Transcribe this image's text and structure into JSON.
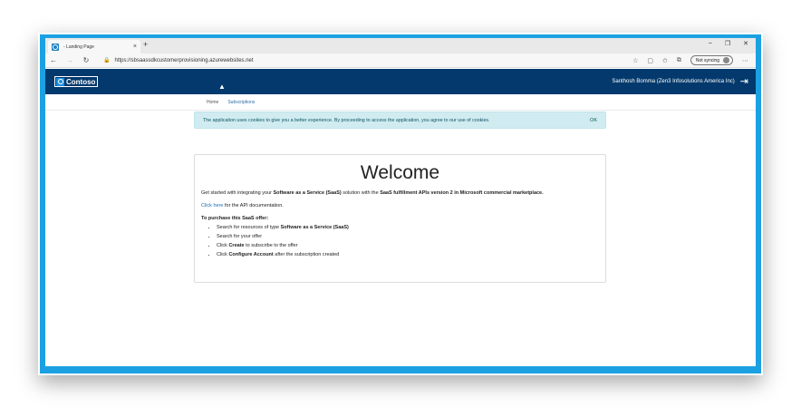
{
  "browser": {
    "tab_title": "- Landing Page",
    "tab_close": "×",
    "new_tab": "+",
    "controls": {
      "minimize": "–",
      "restore": "❐",
      "close": "✕"
    },
    "nav": {
      "back": "←",
      "forward": "→",
      "refresh": "↻",
      "lock": "🔒"
    },
    "url": "https://sbsaassdkcustomerprovisioning.azurewebsites.net",
    "toolbar_icons": {
      "favorite": "☆",
      "collections": "▢",
      "favorites_bar": "✩",
      "extensions": "⧉",
      "more": "⋯"
    },
    "sync_label": "Not syncing"
  },
  "app": {
    "logo_text": "Contoso",
    "user_name": "Santhosh Bomma (Zen3 Infosolutions America Inc)",
    "signout_icon": "⇥",
    "cursor": "▲",
    "subnav": {
      "home": "Home",
      "subscriptions": "Subscriptions"
    },
    "cookie": {
      "text": "The application uses cookies to give you a better experience. By proceeding to access the application, you agree to our use of cookies.",
      "ok": "OK"
    },
    "welcome": {
      "title": "Welcome",
      "intro_1": "Get started with integrating your ",
      "intro_bold_1": "Software as a Service (SaaS)",
      "intro_2": " solution with the ",
      "intro_bold_2": "SaaS fulfillment APIs version 2 in Microsoft commercial marketplace.",
      "doc_link": "Click here",
      "doc_rest": " for the API documentation.",
      "purchase_title": "To purchase this SaaS offer:",
      "step1_pre": "Search for resources of type ",
      "step1_bold": "Software as a Service (SaaS)",
      "step2": "Search for your offer",
      "step3_pre": "Click ",
      "step3_bold": "Create",
      "step3_post": " to subscribe to the offer",
      "step4_pre": "Click ",
      "step4_bold": "Configure Account",
      "step4_post": " after the subscription created"
    }
  }
}
